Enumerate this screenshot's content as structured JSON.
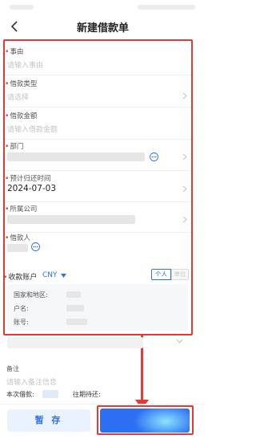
{
  "header": {
    "title": "新建借款单"
  },
  "fields": {
    "reason": {
      "label": "事由",
      "placeholder": "请输入事由"
    },
    "loan_type": {
      "label": "借款类型",
      "placeholder": "请选择"
    },
    "amount": {
      "label": "借款金额",
      "placeholder": "请输入借款金额"
    },
    "department": {
      "label": "部门"
    },
    "return_date": {
      "label": "预计归还时间",
      "value": "2024-07-03"
    },
    "company": {
      "label": "所属公司"
    },
    "borrower": {
      "label": "借款人"
    }
  },
  "account": {
    "label": "收款账户",
    "currency": "CNY",
    "tabs": {
      "personal": "个人",
      "company": "单位"
    },
    "rows": {
      "region": "国家和地区:",
      "name": "户名:",
      "number": "账号:"
    }
  },
  "remark": {
    "label": "备注",
    "placeholder": "请输入备注信息"
  },
  "summary": {
    "loan_label": "本次借款:",
    "due_label": "往期待还:"
  },
  "buttons": {
    "save": "暂 存"
  },
  "colors": {
    "accent": "#2d6ff3",
    "annotation": "#e53935",
    "required": "#e53935"
  },
  "icons": {
    "back": "chevron-left-icon",
    "more": "more-dots-icon",
    "chevron": "chevron-right-icon"
  }
}
